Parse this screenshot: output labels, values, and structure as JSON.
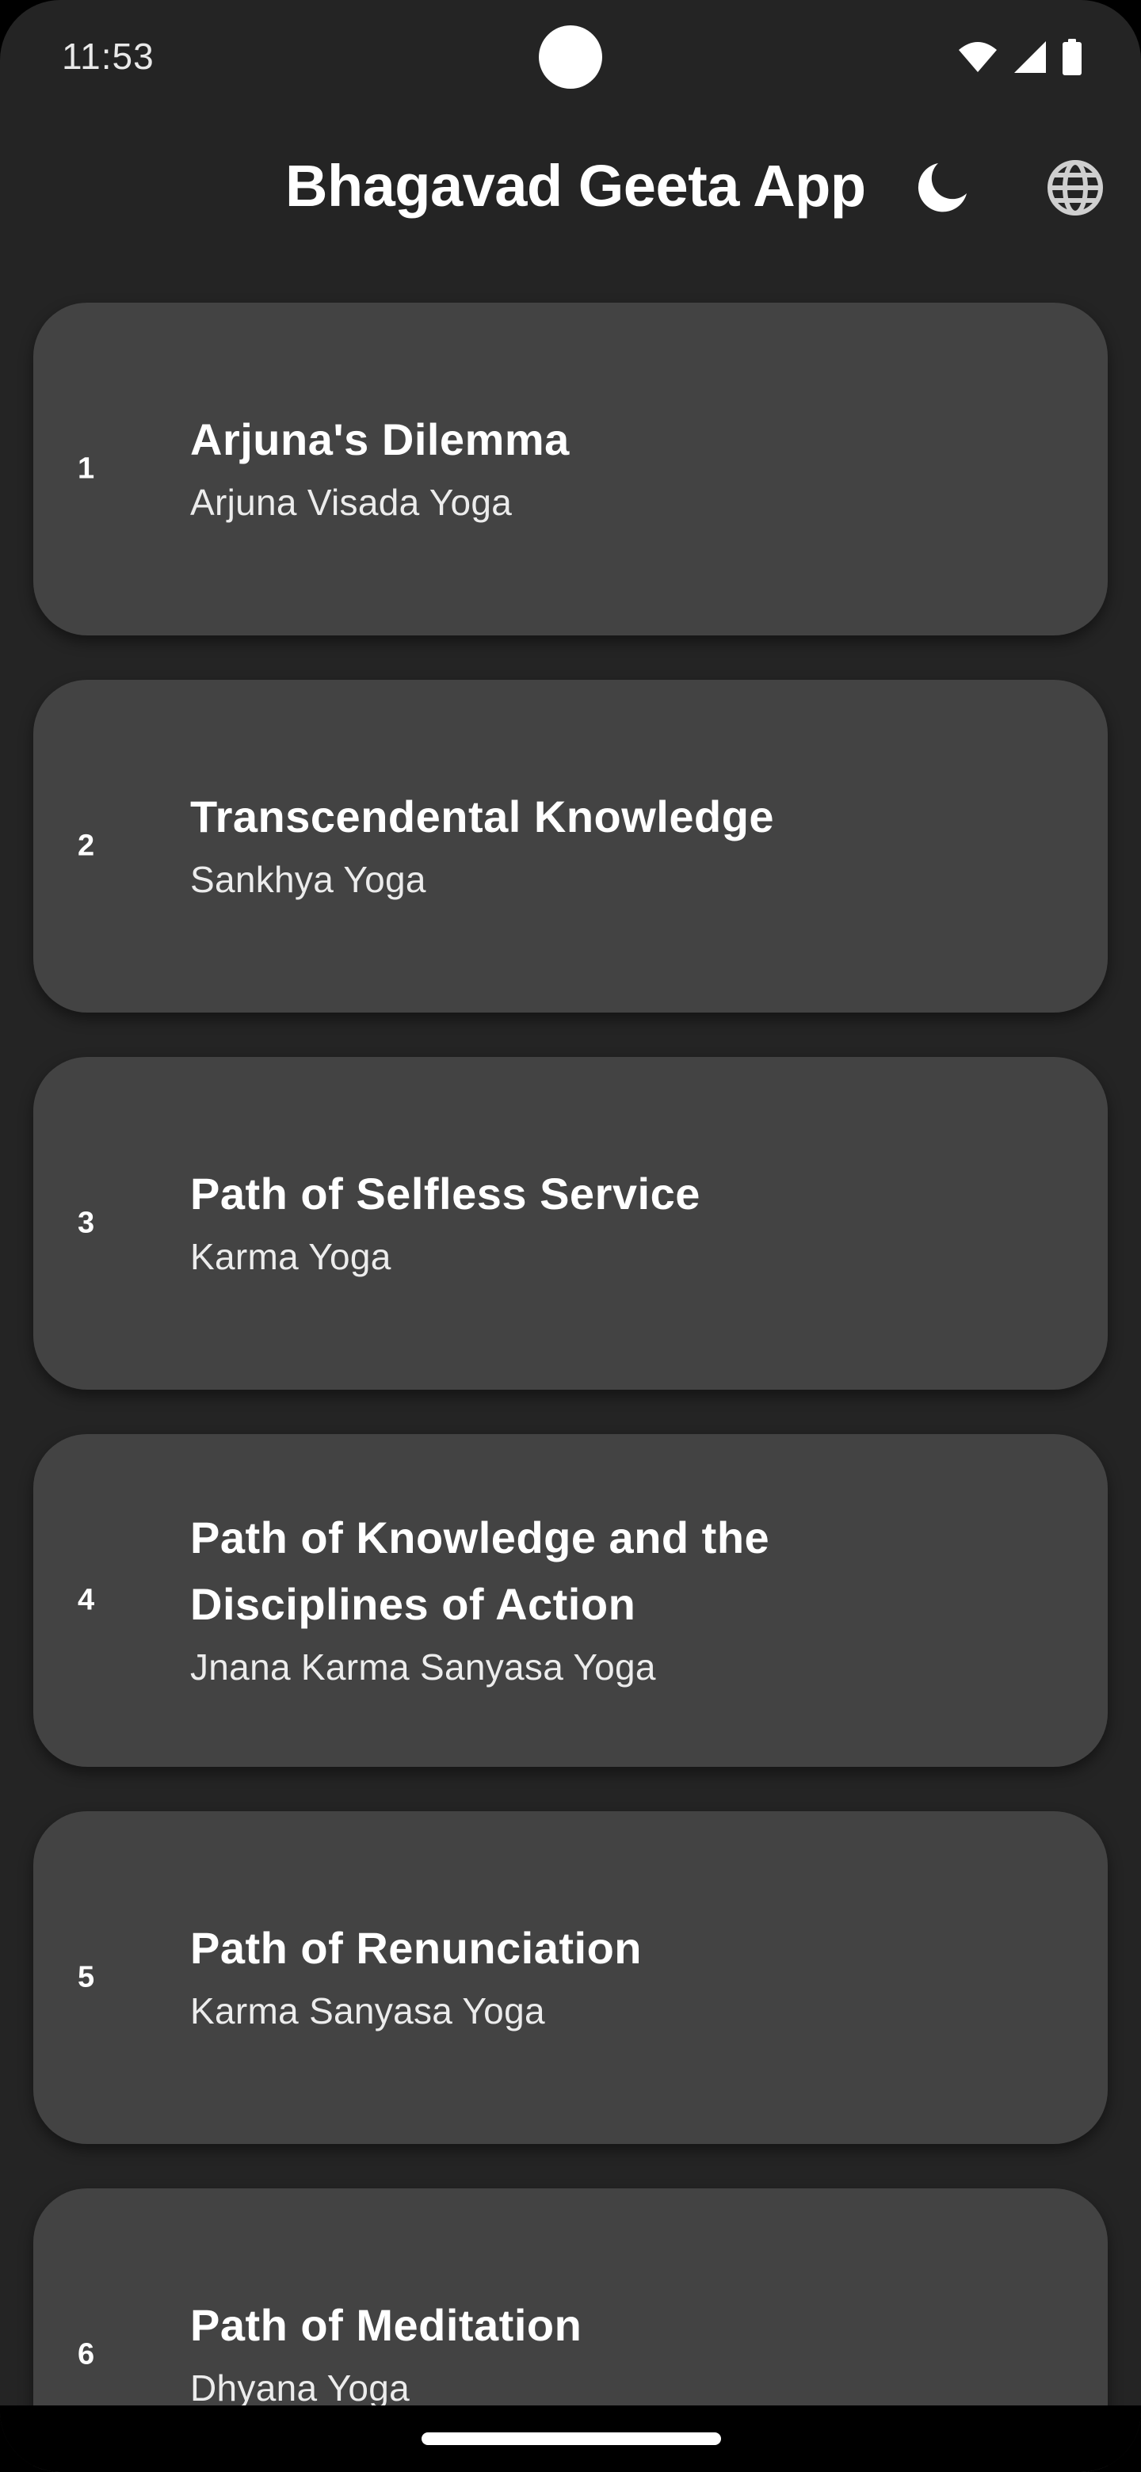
{
  "status_bar": {
    "time": "11:53",
    "icons": [
      "wifi-icon",
      "cell-signal-icon",
      "battery-icon"
    ]
  },
  "app_bar": {
    "title": "Bhagavad Geeta App",
    "actions": [
      "dark-mode-icon",
      "language-globe-icon"
    ]
  },
  "colors": {
    "background": "#242424",
    "card": "#434343",
    "text": "#ffffff"
  },
  "chapters": [
    {
      "number": "1",
      "title": "Arjuna's Dilemma",
      "subtitle": "Arjuna Visada Yoga"
    },
    {
      "number": "2",
      "title": "Transcendental Knowledge",
      "subtitle": "Sankhya Yoga"
    },
    {
      "number": "3",
      "title": "Path of Selfless Service",
      "subtitle": "Karma Yoga"
    },
    {
      "number": "4",
      "title": "Path of Knowledge and the Disciplines of Action",
      "subtitle": "Jnana Karma Sanyasa Yoga"
    },
    {
      "number": "5",
      "title": "Path of Renunciation",
      "subtitle": "Karma Sanyasa Yoga"
    },
    {
      "number": "6",
      "title": "Path of Meditation",
      "subtitle": "Dhyana Yoga"
    }
  ]
}
